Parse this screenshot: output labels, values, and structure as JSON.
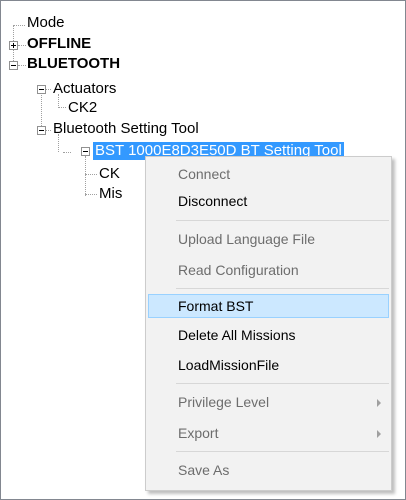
{
  "tree": {
    "mode": "Mode",
    "offline": "OFFLINE",
    "bluetooth": "BLUETOOTH",
    "actuators": "Actuators",
    "ck2_actuator": "CK2",
    "bst_tool": "Bluetooth Setting Tool",
    "bst_device": "BST 1000E8D3E50D BT Setting Tool",
    "child_ck": "CK",
    "child_mis": "Mis"
  },
  "context_menu": {
    "items": [
      {
        "label": "Connect",
        "disabled": true
      },
      {
        "label": "Disconnect",
        "disabled": false
      },
      {
        "label": "Upload Language File",
        "disabled": true
      },
      {
        "label": "Read Configuration",
        "disabled": true
      },
      {
        "label": "Format BST",
        "disabled": false,
        "highlighted": true
      },
      {
        "label": "Delete All Missions",
        "disabled": false
      },
      {
        "label": "LoadMissionFile",
        "disabled": false
      },
      {
        "label": "Privilege Level",
        "disabled": true,
        "submenu": true
      },
      {
        "label": "Export",
        "disabled": true,
        "submenu": true
      },
      {
        "label": "Save As",
        "disabled": true
      }
    ]
  },
  "colors": {
    "selection": "#3399ff",
    "menu_highlight": "#cce8ff",
    "disabled_text": "#6d6d6d"
  },
  "icons": [
    "tree-expand-plus-icon",
    "tree-collapse-minus-icon",
    "submenu-arrow-icon"
  ]
}
